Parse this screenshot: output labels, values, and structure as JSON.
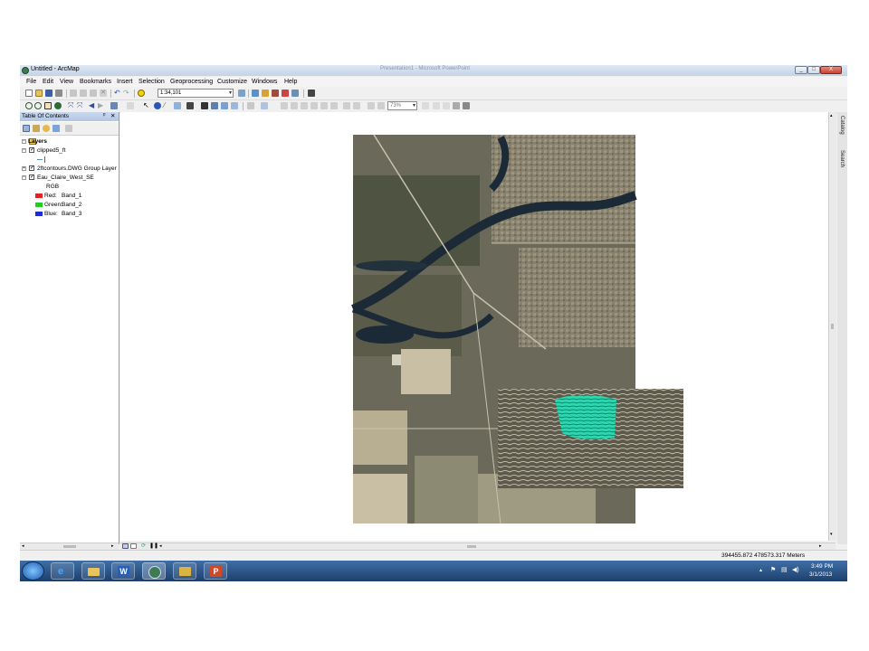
{
  "window": {
    "title": "Untitled - ArcMap",
    "background_app_title": "Presentation1 - Microsoft PowerPoint",
    "controls": [
      "_",
      "□",
      "X"
    ]
  },
  "menu": [
    "File",
    "Edit",
    "View",
    "Bookmarks",
    "Insert",
    "Selection",
    "Geoprocessing",
    "Customize",
    "Windows",
    "Help"
  ],
  "toolbar": {
    "scale_value": "1:34,101",
    "zoom_value": "73%"
  },
  "toc": {
    "title": "Table Of Contents",
    "pin": "ᵖ",
    "close": "✕",
    "root_label": "Layers",
    "layers": [
      {
        "name": "clipped5_ft",
        "checked": true,
        "expanded": true
      },
      {
        "name": "2ftcontours.DWG Group Layer",
        "checked": true,
        "expanded": false
      },
      {
        "name": "Eau_Claire_West_SE",
        "checked": true,
        "expanded": true
      }
    ],
    "rgb_label": "RGB",
    "bands": [
      {
        "channel": "Red:",
        "band": "Band_1",
        "color": "#e52020"
      },
      {
        "channel": "Green:",
        "band": "Band_2",
        "color": "#22cc22"
      },
      {
        "channel": "Blue:",
        "band": "Band_3",
        "color": "#1c2bd6"
      }
    ]
  },
  "side_dock": [
    "Catalog",
    "Search"
  ],
  "status": {
    "coordinates": "394455.872  478573.317 Meters"
  },
  "taskbar": {
    "time": "3:49 PM",
    "date": "3/1/2013",
    "apps": [
      "start-orb",
      "internet-explorer",
      "windows-explorer",
      "word",
      "arcmap",
      "arccatalog",
      "powerpoint"
    ]
  },
  "colors": {
    "contour_highlight": "#36e0b8",
    "river": "#1b2a36",
    "taskbar": "#2a528a"
  }
}
